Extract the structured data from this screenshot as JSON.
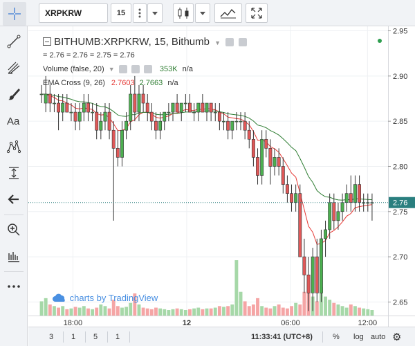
{
  "toolbar": {
    "symbol": "XRPKRW",
    "interval": "15"
  },
  "legend": {
    "title": "BITHUMB:XRPKRW, 15, Bithumb",
    "ohlc": "= 2.76 = 2.76 = 2.75 = 2.76",
    "volume_label": "Volume (false, 20)",
    "volume_value": "353K",
    "volume_na": "n/a",
    "ema_label": "EMA Cross (9, 26)",
    "ema_fast": "2.7603",
    "ema_slow": "2.7663",
    "ema_na": "n/a"
  },
  "watermark": "charts by TradingView",
  "bottom": {
    "ranges": [
      "3",
      "1",
      "5",
      "1"
    ],
    "time": "11:33:41 (UTC+8)",
    "pct": "%",
    "log": "log",
    "auto": "auto"
  },
  "colors": {
    "up": "#4caf50",
    "down": "#e05858",
    "up_vol": "#a6d8a8",
    "down_vol": "#f5a5a5",
    "ema_fast": "#e53935",
    "ema_slow": "#2e7d32",
    "price_line": "#2a7f7f"
  },
  "chart_data": {
    "type": "candlestick",
    "price_axis": {
      "ticks": [
        "2.95",
        "2.90",
        "2.85",
        "2.80",
        "2.75",
        "2.70",
        "2.65"
      ],
      "last_price": "2.76",
      "range": [
        2.635,
        2.955
      ]
    },
    "time_axis": {
      "ticks": [
        "18:00",
        "12",
        "06:00",
        "12:00"
      ]
    },
    "candles": [
      [
        2.88,
        2.89,
        2.87,
        2.88
      ],
      [
        2.87,
        2.9,
        2.86,
        2.88
      ],
      [
        2.88,
        2.89,
        2.86,
        2.87
      ],
      [
        2.87,
        2.88,
        2.86,
        2.87
      ],
      [
        2.87,
        2.88,
        2.84,
        2.86
      ],
      [
        2.86,
        2.88,
        2.85,
        2.87
      ],
      [
        2.87,
        2.88,
        2.86,
        2.86
      ],
      [
        2.86,
        2.87,
        2.85,
        2.86
      ],
      [
        2.86,
        2.87,
        2.84,
        2.85
      ],
      [
        2.85,
        2.87,
        2.84,
        2.86
      ],
      [
        2.86,
        2.88,
        2.85,
        2.87
      ],
      [
        2.87,
        2.88,
        2.85,
        2.86
      ],
      [
        2.86,
        2.87,
        2.85,
        2.86
      ],
      [
        2.86,
        2.87,
        2.83,
        2.84
      ],
      [
        2.84,
        2.86,
        2.83,
        2.85
      ],
      [
        2.85,
        2.87,
        2.84,
        2.86
      ],
      [
        2.86,
        2.87,
        2.83,
        2.84
      ],
      [
        2.84,
        2.85,
        2.74,
        2.82
      ],
      [
        2.82,
        2.84,
        2.8,
        2.81
      ],
      [
        2.81,
        2.85,
        2.8,
        2.84
      ],
      [
        2.84,
        2.86,
        2.83,
        2.85
      ],
      [
        2.85,
        2.89,
        2.84,
        2.88
      ],
      [
        2.88,
        2.9,
        2.85,
        2.86
      ],
      [
        2.86,
        2.89,
        2.85,
        2.88
      ],
      [
        2.88,
        2.89,
        2.86,
        2.87
      ],
      [
        2.87,
        2.88,
        2.85,
        2.86
      ],
      [
        2.86,
        2.87,
        2.84,
        2.85
      ],
      [
        2.85,
        2.86,
        2.83,
        2.84
      ],
      [
        2.84,
        2.86,
        2.83,
        2.85
      ],
      [
        2.85,
        2.86,
        2.84,
        2.86
      ],
      [
        2.86,
        2.87,
        2.85,
        2.86
      ],
      [
        2.86,
        2.87,
        2.85,
        2.87
      ],
      [
        2.87,
        2.88,
        2.86,
        2.86
      ],
      [
        2.86,
        2.87,
        2.85,
        2.87
      ],
      [
        2.87,
        2.88,
        2.86,
        2.87
      ],
      [
        2.87,
        2.88,
        2.86,
        2.86
      ],
      [
        2.86,
        2.87,
        2.85,
        2.86
      ],
      [
        2.86,
        2.87,
        2.85,
        2.87
      ],
      [
        2.87,
        2.88,
        2.86,
        2.86
      ],
      [
        2.86,
        2.87,
        2.85,
        2.87
      ],
      [
        2.87,
        2.87,
        2.85,
        2.86
      ],
      [
        2.86,
        2.87,
        2.85,
        2.86
      ],
      [
        2.86,
        2.87,
        2.84,
        2.85
      ],
      [
        2.85,
        2.86,
        2.84,
        2.85
      ],
      [
        2.85,
        2.86,
        2.83,
        2.84
      ],
      [
        2.84,
        2.85,
        2.83,
        2.85
      ],
      [
        2.85,
        2.86,
        2.84,
        2.85
      ],
      [
        2.85,
        2.86,
        2.84,
        2.85
      ],
      [
        2.85,
        2.86,
        2.83,
        2.84
      ],
      [
        2.84,
        2.85,
        2.82,
        2.83
      ],
      [
        2.83,
        2.84,
        2.8,
        2.81
      ],
      [
        2.81,
        2.82,
        2.78,
        2.79
      ],
      [
        2.79,
        2.84,
        2.78,
        2.83
      ],
      [
        2.83,
        2.84,
        2.81,
        2.82
      ],
      [
        2.82,
        2.83,
        2.78,
        2.8
      ],
      [
        2.8,
        2.82,
        2.79,
        2.81
      ],
      [
        2.81,
        2.82,
        2.79,
        2.8
      ],
      [
        2.8,
        2.81,
        2.77,
        2.78
      ],
      [
        2.78,
        2.79,
        2.76,
        2.77
      ],
      [
        2.77,
        2.78,
        2.75,
        2.76
      ],
      [
        2.76,
        2.78,
        2.75,
        2.77
      ],
      [
        2.77,
        2.78,
        2.72,
        2.7
      ],
      [
        2.7,
        2.72,
        2.66,
        2.68
      ],
      [
        2.68,
        2.7,
        2.64,
        2.66
      ],
      [
        2.66,
        2.71,
        2.64,
        2.7
      ],
      [
        2.7,
        2.72,
        2.65,
        2.66
      ],
      [
        2.66,
        2.73,
        2.65,
        2.72
      ],
      [
        2.72,
        2.74,
        2.7,
        2.73
      ],
      [
        2.73,
        2.77,
        2.72,
        2.76
      ],
      [
        2.76,
        2.77,
        2.73,
        2.74
      ],
      [
        2.74,
        2.76,
        2.73,
        2.75
      ],
      [
        2.75,
        2.77,
        2.74,
        2.76
      ],
      [
        2.76,
        2.78,
        2.75,
        2.77
      ],
      [
        2.77,
        2.79,
        2.75,
        2.76
      ],
      [
        2.76,
        2.79,
        2.75,
        2.78
      ],
      [
        2.78,
        2.79,
        2.75,
        2.76
      ],
      [
        2.76,
        2.77,
        2.75,
        2.76
      ],
      [
        2.76,
        2.77,
        2.75,
        2.76
      ],
      [
        2.76,
        2.77,
        2.74,
        2.76
      ]
    ],
    "volumes": [
      18,
      22,
      14,
      12,
      10,
      12,
      8,
      9,
      11,
      10,
      12,
      9,
      8,
      10,
      14,
      12,
      9,
      20,
      12,
      10,
      11,
      16,
      28,
      14,
      10,
      9,
      8,
      10,
      9,
      8,
      7,
      8,
      9,
      8,
      7,
      8,
      9,
      10,
      8,
      9,
      9,
      10,
      12,
      11,
      12,
      14,
      70,
      30,
      18,
      12,
      14,
      22,
      12,
      10,
      9,
      12,
      14,
      10,
      9,
      12,
      16,
      14,
      30,
      42,
      24,
      18,
      36,
      24,
      20,
      16,
      14,
      12,
      10,
      14,
      12,
      10,
      9,
      8,
      7
    ]
  }
}
